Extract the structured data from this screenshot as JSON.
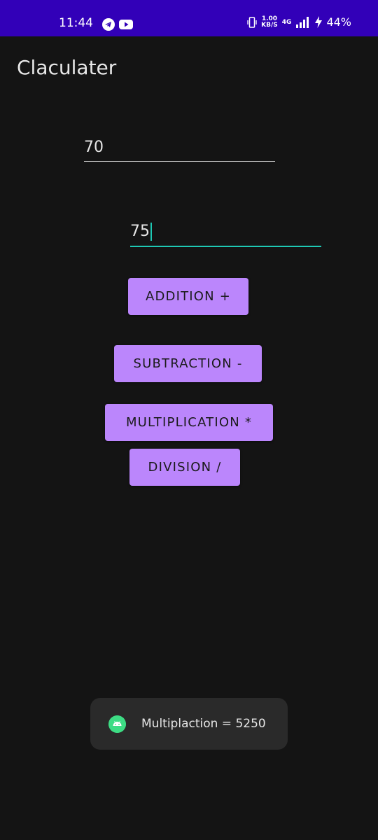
{
  "status_bar": {
    "time": "11:44",
    "left_icons": [
      "telegram-icon",
      "youtube-icon"
    ],
    "net_speed_value": "1.00",
    "net_speed_unit": "KB/S",
    "network_label": "4G",
    "battery": "44%",
    "right_icons": [
      "vibrate-icon",
      "signal-icon",
      "charging-icon"
    ]
  },
  "app": {
    "title": "Claculater"
  },
  "inputs": {
    "first_value": "70",
    "second_value": "75"
  },
  "buttons": {
    "add": "ADDITION +",
    "subtract": "SUBTRACTION -",
    "multiply": "MULTIPLICATION *",
    "divide": "DIVISION /"
  },
  "toast": {
    "message": "Multiplaction = 5250",
    "icon": "android-icon"
  },
  "colors": {
    "status_bar": "#3200b8",
    "background": "#141414",
    "button": "#bb86fc",
    "focus_line": "#1ec8b4",
    "toast_bg": "#2a2a2a"
  }
}
